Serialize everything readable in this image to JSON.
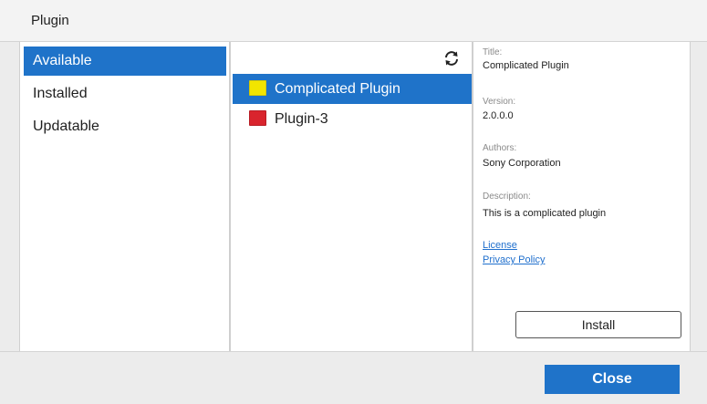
{
  "window": {
    "title": "Plugin"
  },
  "categories": [
    {
      "label": "Available",
      "selected": true
    },
    {
      "label": "Installed",
      "selected": false
    },
    {
      "label": "Updatable",
      "selected": false
    }
  ],
  "plugin_list": {
    "refresh_icon": "refresh-icon",
    "items": [
      {
        "label": "Complicated Plugin",
        "color": "#f2e500",
        "selected": true
      },
      {
        "label": "Plugin-3",
        "color": "#d9242d",
        "selected": false
      }
    ]
  },
  "details": {
    "title_label": "Title:",
    "title_value": "Complicated Plugin",
    "version_label": "Version:",
    "version_value": "2.0.0.0",
    "authors_label": "Authors:",
    "authors_value": "Sony Corporation",
    "description_label": "Description:",
    "description_value": "This is a complicated plugin",
    "license_link": "License",
    "privacy_link": "Privacy Policy",
    "install_label": "Install"
  },
  "footer": {
    "close_label": "Close"
  },
  "colors": {
    "accent": "#1f73c9",
    "link": "#1f6fcd"
  }
}
